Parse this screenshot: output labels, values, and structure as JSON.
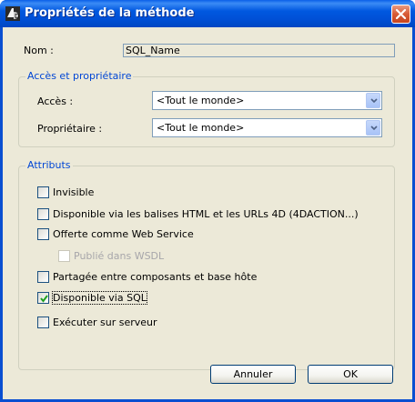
{
  "window": {
    "title": "Propriétés de la méthode",
    "app_icon": "4d-app-icon",
    "close_icon": "close-icon",
    "title_color": "#0054e3"
  },
  "nom": {
    "label": "Nom :",
    "value": "SQL_Name"
  },
  "access_group": {
    "title": "Accès et propriétaire",
    "acces_label": "Accès :",
    "acces_value": "<Tout le monde>",
    "proprietaire_label": "Propriétaire :",
    "proprietaire_value": "<Tout le monde>"
  },
  "attributes_group": {
    "title": "Attributs",
    "items": [
      {
        "label": "Invisible",
        "checked": false,
        "enabled": true
      },
      {
        "label": "Disponible via les balises HTML et les URLs 4D (4DACTION...)",
        "checked": false,
        "enabled": true
      },
      {
        "label": "Offerte comme Web Service",
        "checked": false,
        "enabled": true
      },
      {
        "label": "Publié dans WSDL",
        "checked": false,
        "enabled": false
      },
      {
        "label": "Partagée entre composants et base hôte",
        "checked": false,
        "enabled": true
      },
      {
        "label": "Disponible via SQL",
        "checked": true,
        "enabled": true
      },
      {
        "label": "Exécuter sur serveur",
        "checked": false,
        "enabled": true
      }
    ]
  },
  "buttons": {
    "cancel": "Annuler",
    "ok": "OK"
  },
  "colors": {
    "group_title": "#0046d5",
    "dialog_bg": "#ece9d8",
    "check_mark": "#21a121"
  }
}
